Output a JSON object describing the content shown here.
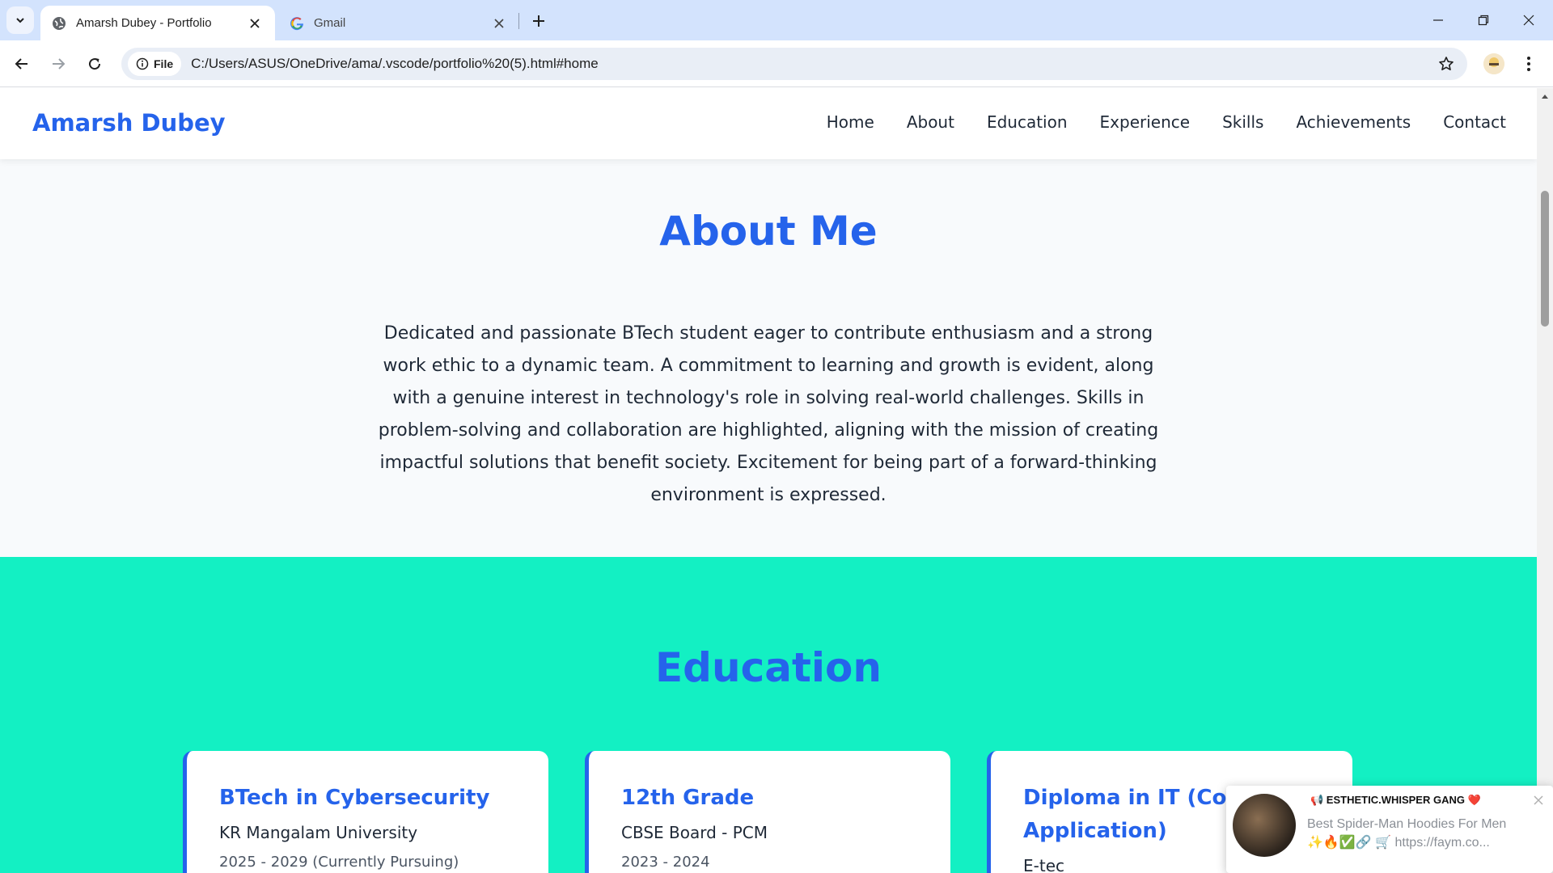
{
  "browser": {
    "tabs": [
      {
        "title": "Amarsh Dubey - Portfolio",
        "active": true,
        "icon": "globe-icon"
      },
      {
        "title": "Gmail",
        "active": false,
        "icon": "google-icon"
      }
    ],
    "address": {
      "chip_label": "File",
      "url": "C:/Users/ASUS/OneDrive/ama/.vscode/portfolio%20(5).html#home"
    }
  },
  "site": {
    "brand": "Amarsh Dubey",
    "nav": [
      "Home",
      "About",
      "Education",
      "Experience",
      "Skills",
      "Achievements",
      "Contact"
    ],
    "about": {
      "title": "About Me",
      "text": "Dedicated and passionate BTech student eager to contribute enthusiasm and a strong work ethic to a dynamic team. A commitment to learning and growth is evident, along with a genuine interest in technology's role in solving real-world challenges. Skills in problem-solving and collaboration are highlighted, aligning with the mission of creating impactful solutions that benefit society. Excitement for being part of a forward-thinking environment is expressed."
    },
    "education": {
      "title": "Education",
      "cards": [
        {
          "degree": "BTech in Cybersecurity",
          "institution": "KR Mangalam University",
          "period": "2025 - 2029 (Currently Pursuing)"
        },
        {
          "degree": "12th Grade",
          "institution": "CBSE Board - PCM",
          "period": "2023 - 2024"
        },
        {
          "degree": "Diploma in IT (Computer Application)",
          "institution": "E-tec",
          "period": ""
        }
      ]
    }
  },
  "notification": {
    "title": "📢 ESTHETIC.WHISPER GANG ❤️",
    "body": "Best Spider-Man Hoodies For Men ✨🔥✅🔗 🛒 https://faym.co..."
  },
  "colors": {
    "brand_blue": "#2563eb",
    "education_bg": "#13f0c3",
    "tabstrip_bg": "#d3e3fd"
  }
}
